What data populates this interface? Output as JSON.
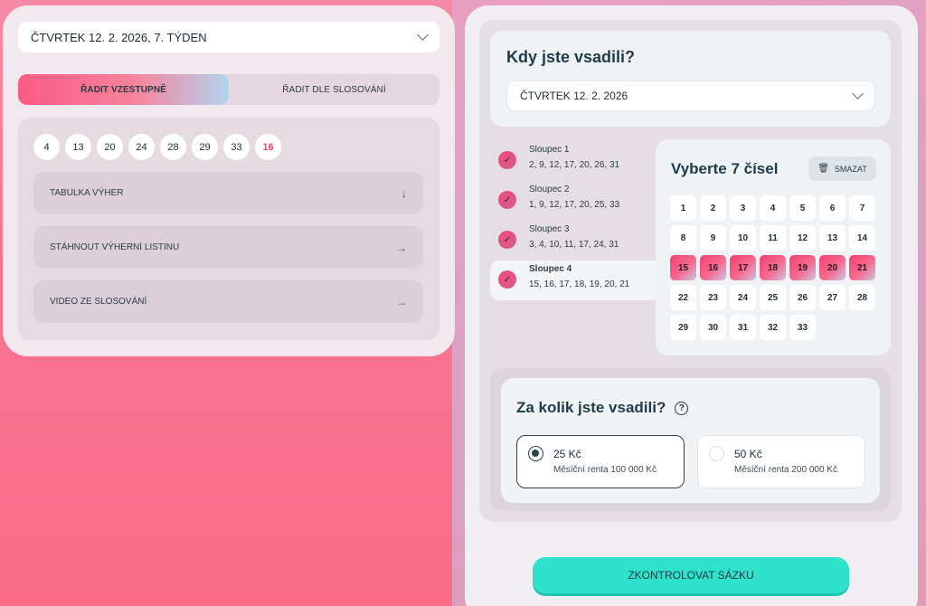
{
  "left": {
    "draw_date": "ČTVRTEK 12. 2. 2026, 7. TÝDEN",
    "sort": {
      "ascending": "ŘADIT VZESTUPNĚ",
      "by_draw": "ŘADIT DLE SLOSOVÁNÍ"
    },
    "numbers": [
      "4",
      "13",
      "20",
      "24",
      "28",
      "29",
      "33"
    ],
    "extra_number": "16",
    "rows": {
      "wins_table": "TABULKA VÝHER",
      "download": "STÁHNOUT VÝHERNÍ LISTINU",
      "video": "VIDEO ZE SLOSOVÁNÍ"
    }
  },
  "right": {
    "when_title": "Kdy jste vsadili?",
    "when_date": "ČTVRTEK 12. 2. 2026",
    "columns": [
      {
        "name": "Sloupec 1",
        "numbers": "2, 9, 12, 17, 20, 26, 31"
      },
      {
        "name": "Sloupec 2",
        "numbers": "1, 9, 12, 17, 20, 25, 33"
      },
      {
        "name": "Sloupec 3",
        "numbers": "3, 4, 10, 11, 17, 24, 31"
      },
      {
        "name": "Sloupec 4",
        "numbers": "15, 16, 17, 18, 19, 20, 21"
      }
    ],
    "pick_title": "Vyberte 7 čísel",
    "clear_label": "SMAZAT",
    "grid_numbers": [
      "1",
      "2",
      "3",
      "4",
      "5",
      "6",
      "7",
      "8",
      "9",
      "10",
      "11",
      "12",
      "13",
      "14",
      "15",
      "16",
      "17",
      "18",
      "19",
      "20",
      "21",
      "22",
      "23",
      "24",
      "25",
      "26",
      "27",
      "28",
      "29",
      "30",
      "31",
      "32",
      "33"
    ],
    "selected_numbers": [
      15,
      16,
      17,
      18,
      19,
      20,
      21
    ],
    "stake_title": "Za kolik jste vsadili?",
    "stakes": [
      {
        "price": "25 Kč",
        "rent": "Měsíční renta 100 000 Kč",
        "selected": true
      },
      {
        "price": "50 Kč",
        "rent": "Měsíční renta 200 000 Kč",
        "selected": false
      }
    ],
    "submit_label": "ZKONTROLOVAT SÁZKU"
  },
  "colors": {
    "accent_pink": "#f43f72",
    "accent_teal": "#2ee2cc",
    "text_dark": "#1f3b4a"
  }
}
